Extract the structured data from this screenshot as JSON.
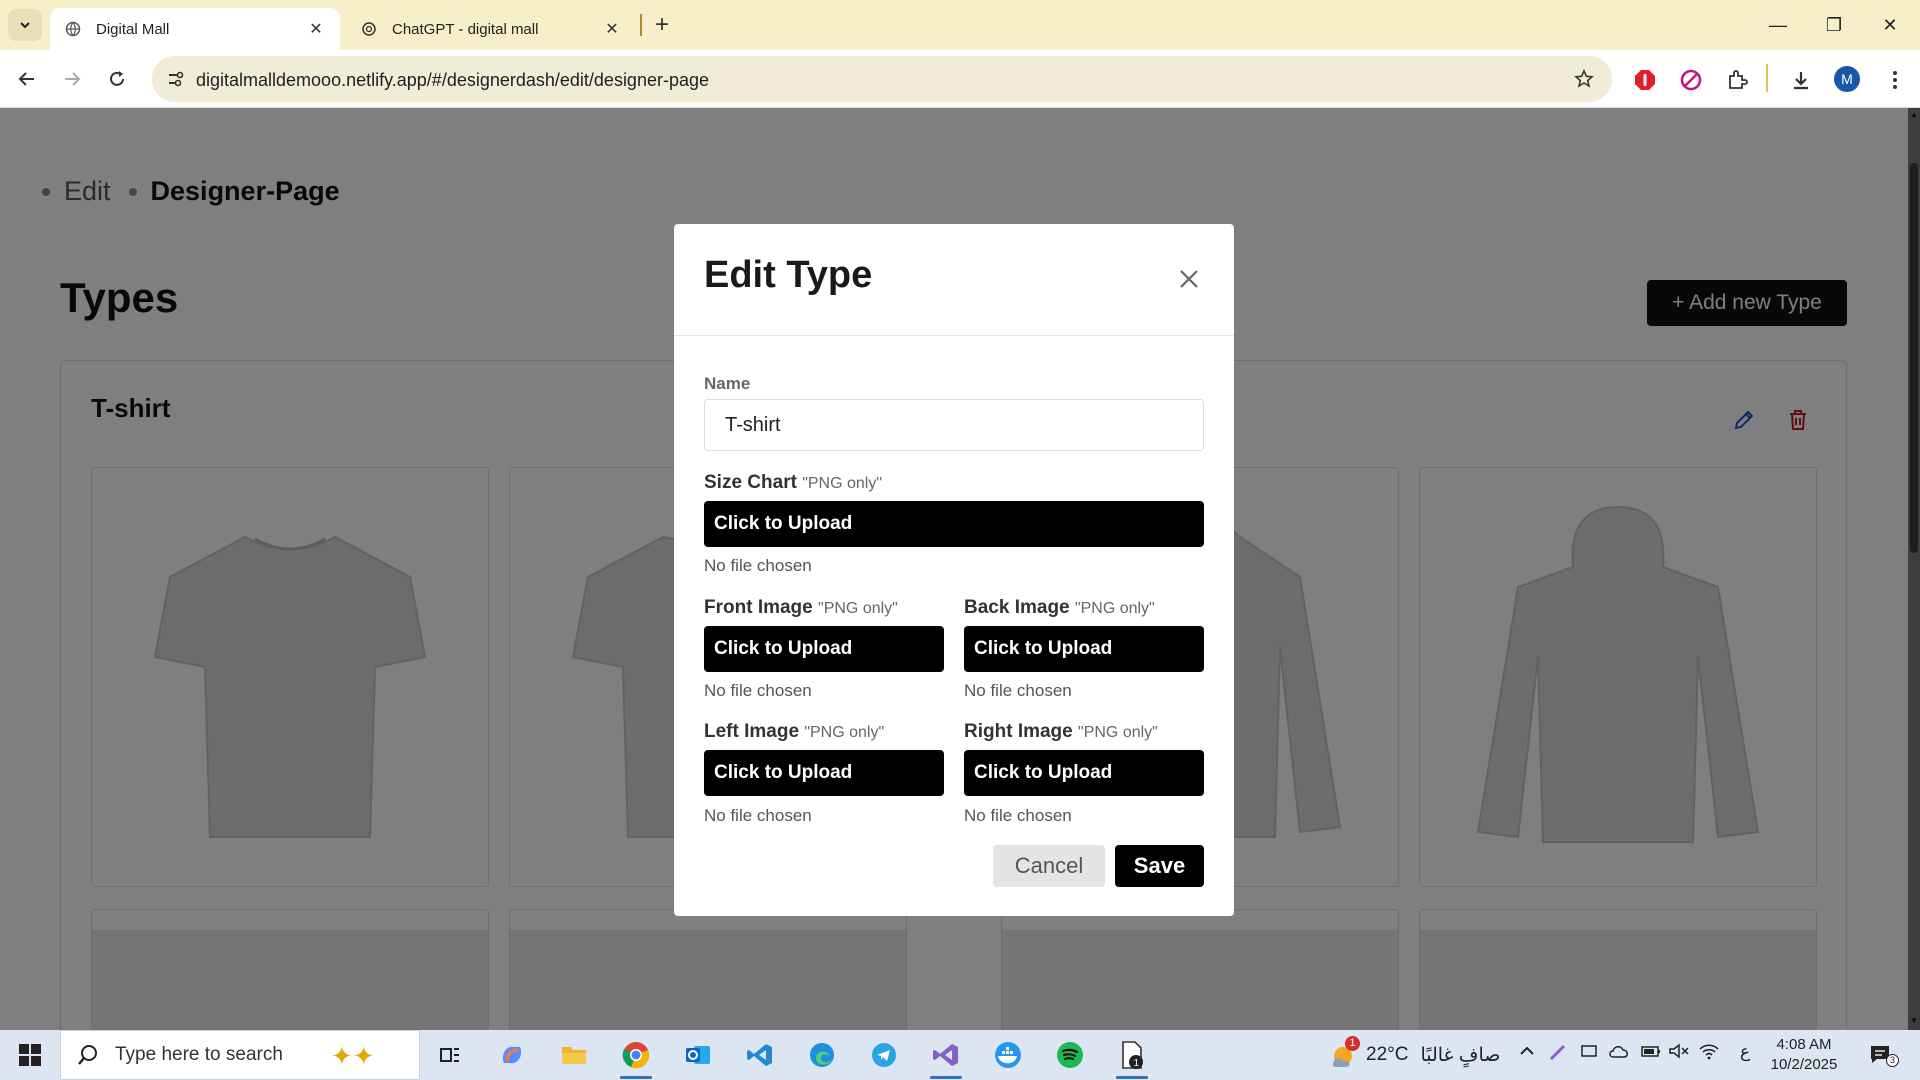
{
  "browser": {
    "tabs": [
      {
        "title": "Digital Mall",
        "active": true
      },
      {
        "title": "ChatGPT - digital mall",
        "active": false
      }
    ],
    "url": "digitalmalldemooo.netlify.app/#/designerdash/edit/designer-page",
    "profile_initial": "M",
    "icons": [
      "tab-search-icon",
      "back-arrow-icon",
      "forward-arrow-icon",
      "reload-icon",
      "site-info-icon",
      "bookmark-star-icon",
      "extensions-icon",
      "download-icon",
      "more-menu-icon"
    ]
  },
  "page": {
    "breadcrumb": [
      "Edit",
      "Designer-Page"
    ],
    "title": "Types",
    "add_button": "+ Add new Type",
    "card_title": "T-shirt"
  },
  "modal": {
    "title": "Edit Type",
    "name_label": "Name",
    "name_value": "T-shirt",
    "png_hint": "\"PNG only\"",
    "upload_label": "Click to Upload",
    "no_file": "No file chosen",
    "fields": {
      "size_chart": "Size Chart",
      "front": "Front Image",
      "back": "Back Image",
      "left": "Left Image",
      "right": "Right Image"
    },
    "cancel": "Cancel",
    "save": "Save"
  },
  "taskbar": {
    "search_placeholder": "Type here to search",
    "weather_badge": "1",
    "weather_temp": "22°C",
    "weather_text": "صافٍ غالبًا",
    "lang": "ع",
    "time": "4:08 AM",
    "date": "10/2/2025",
    "notif_count": "3",
    "file_badge": "1"
  },
  "colors": {
    "accent_black": "#000000",
    "edit_blue": "#1f4fd1",
    "delete_red": "#c41e1e",
    "tab_bar": "#f7efc9"
  }
}
